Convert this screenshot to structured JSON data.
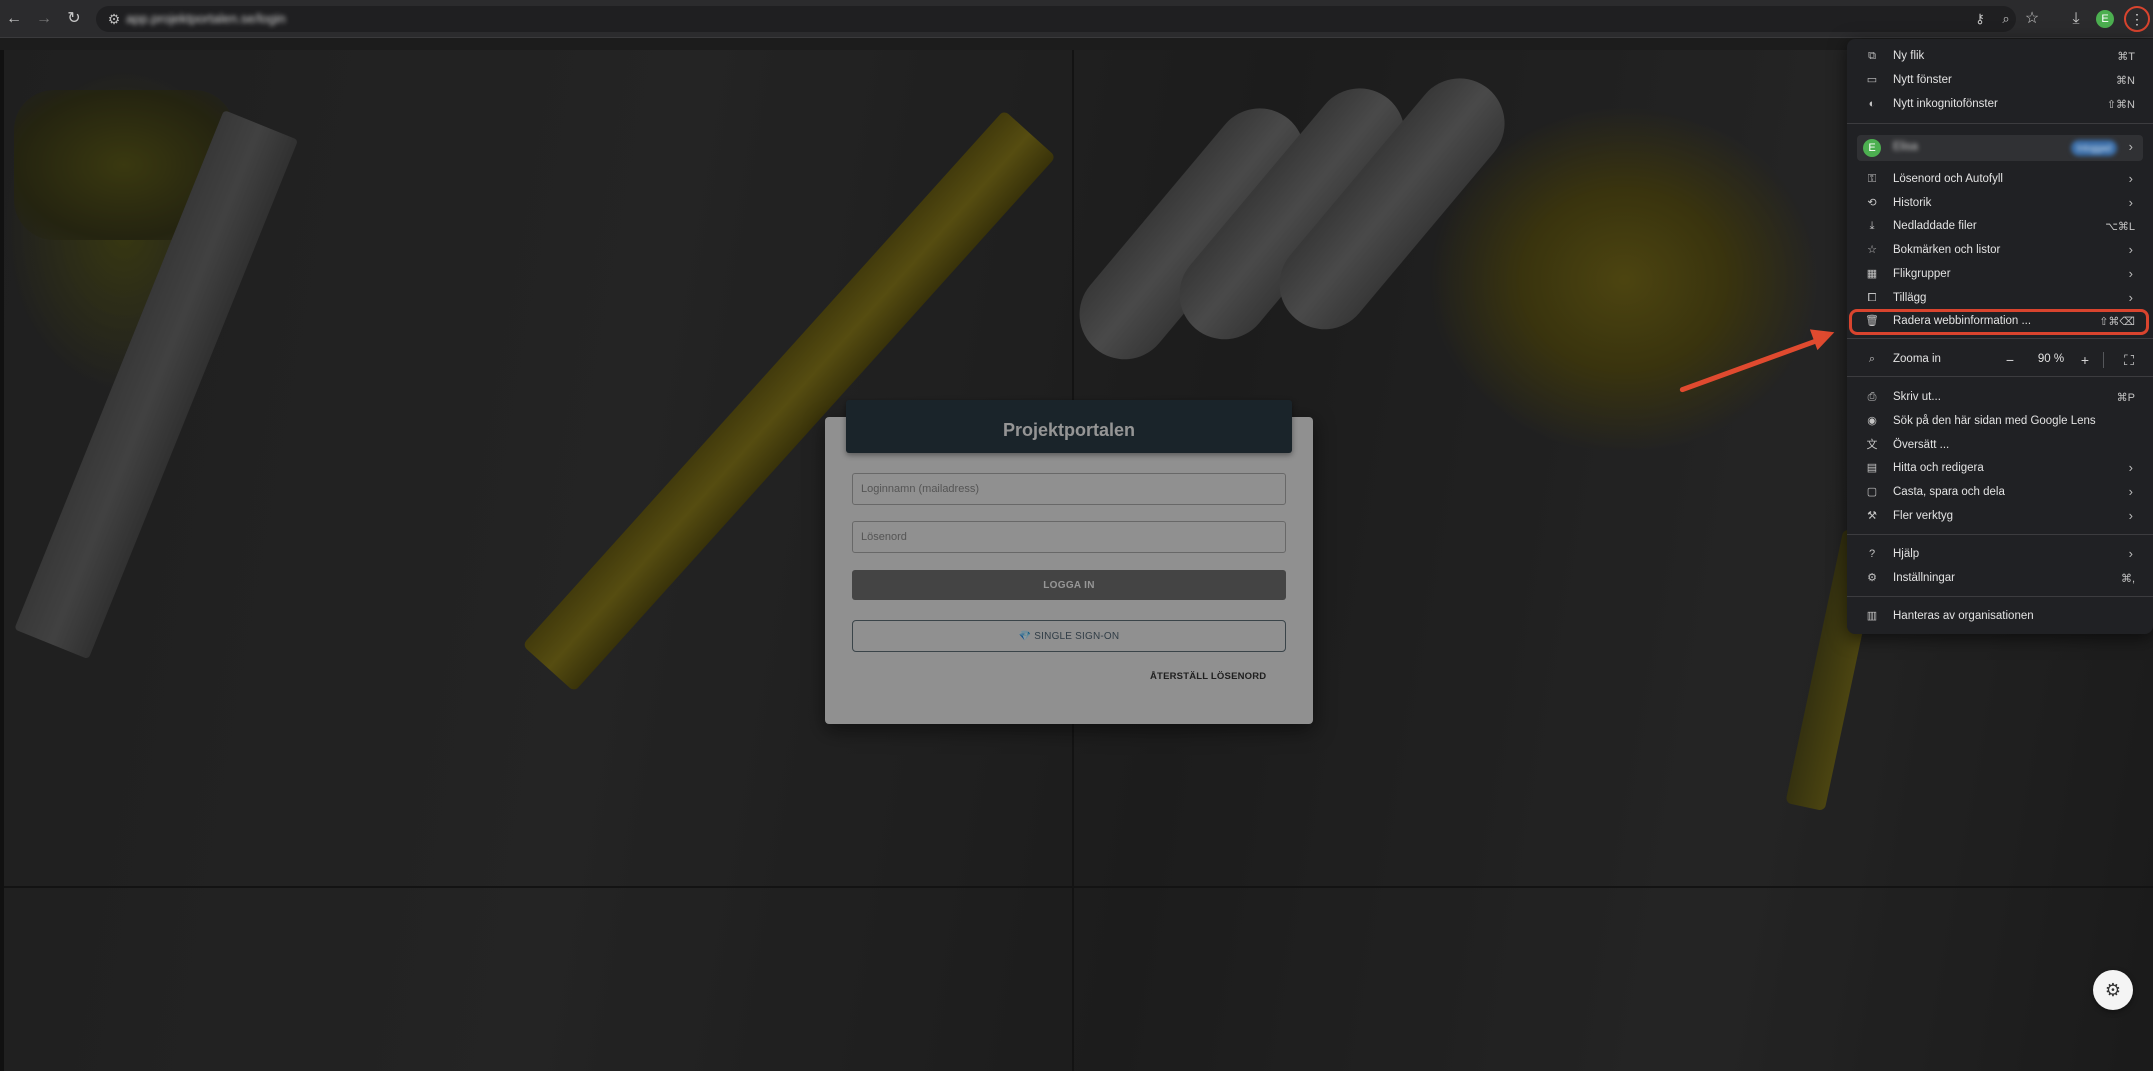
{
  "browser": {
    "url": "app.projektportalen.se/login",
    "profile_initial": "E"
  },
  "login": {
    "title": "Projektportalen",
    "username_placeholder": "Loginnamn (mailadress)",
    "password_placeholder": "Lösenord",
    "login_button": "LOGGA IN",
    "sso_icon": "💎",
    "sso_button": "SINGLE SIGN-ON",
    "reset_link": "ÅTERSTÄLL LÖSENORD"
  },
  "menu": {
    "items_top": [
      {
        "label": "Ny flik",
        "shortcut": "⌘T",
        "icon": "new-tab-icon"
      },
      {
        "label": "Nytt fönster",
        "shortcut": "⌘N",
        "icon": "new-window-icon"
      },
      {
        "label": "Nytt inkognitofönster",
        "shortcut": "⇧⌘N",
        "icon": "incognito-icon"
      }
    ],
    "profile": {
      "initial": "E",
      "name": "Elisa",
      "badge": "Inloggad"
    },
    "items_mid": [
      {
        "label": "Lösenord och Autofyll",
        "icon": "key-icon",
        "has_submenu": true
      },
      {
        "label": "Historik",
        "icon": "history-icon",
        "has_submenu": true
      },
      {
        "label": "Nedladdade filer",
        "shortcut": "⌥⌘L",
        "icon": "download-icon"
      },
      {
        "label": "Bokmärken och listor",
        "icon": "star-icon",
        "has_submenu": true
      },
      {
        "label": "Flikgrupper",
        "icon": "tab-groups-icon",
        "has_submenu": true
      },
      {
        "label": "Tillägg",
        "icon": "extension-icon",
        "has_submenu": true
      },
      {
        "label": "Radera webbinformation ...",
        "shortcut": "⇧⌘⌫",
        "icon": "trash-icon"
      }
    ],
    "zoom": {
      "label": "Zooma in",
      "value": "90 %",
      "minus": "−",
      "plus": "+"
    },
    "items_tools": [
      {
        "label": "Skriv ut...",
        "shortcut": "⌘P",
        "icon": "print-icon"
      },
      {
        "label": "Sök på den här sidan med Google Lens",
        "icon": "lens-icon"
      },
      {
        "label": "Översätt ...",
        "icon": "translate-icon"
      },
      {
        "label": "Hitta och redigera",
        "icon": "find-icon",
        "has_submenu": true
      },
      {
        "label": "Casta, spara och dela",
        "icon": "cast-icon",
        "has_submenu": true
      },
      {
        "label": "Fler verktyg",
        "icon": "tools-icon",
        "has_submenu": true
      }
    ],
    "items_help": [
      {
        "label": "Hjälp",
        "icon": "help-icon",
        "has_submenu": true
      },
      {
        "label": "Inställningar",
        "shortcut": "⌘,",
        "icon": "settings-icon"
      }
    ],
    "managed": {
      "label": "Hanteras av organisationen",
      "icon": "building-icon"
    }
  },
  "colors": {
    "accent_highlight": "#d9442e",
    "header_bg": "#2b3b44",
    "login_button_bg": "#6e6e6e"
  }
}
